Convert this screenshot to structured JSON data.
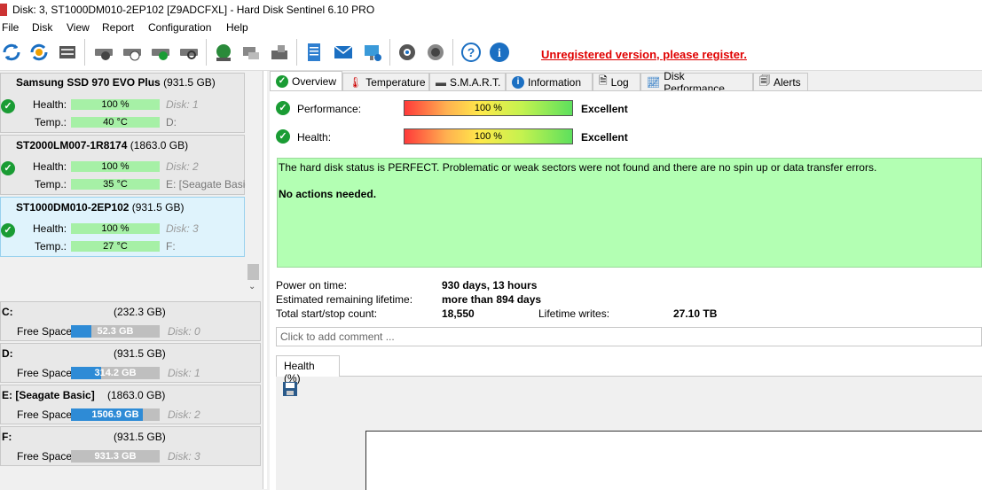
{
  "window": {
    "title": "Disk: 3, ST1000DM010-2EP102 [Z9ADCFXL]  -  Hard Disk Sentinel 6.10 PRO"
  },
  "menu": [
    "File",
    "Disk",
    "View",
    "Report",
    "Configuration",
    "Help"
  ],
  "toolbar": {
    "icons": [
      "refresh-icon",
      "refresh-all-icon",
      "disk-list-icon",
      "disk-test-icon",
      "disk-schedule-icon",
      "disk-ok-icon",
      "disk-search-icon",
      "web-update-icon",
      "network-icon",
      "drive-tools-icon",
      "report-icon",
      "email-icon",
      "alert-icon",
      "settings-icon",
      "sound-icon",
      "help-icon",
      "info-icon"
    ],
    "register_message": "Unregistered version, please register."
  },
  "disks": [
    {
      "name": "Samsung SSD 970 EVO Plus",
      "size": "(931.5 GB)",
      "health_label": "Health:",
      "health": "100 %",
      "health_pct": 100,
      "temp_label": "Temp.:",
      "temp": "40 °C",
      "temp_pct": 40,
      "disk_num": "Disk: 1",
      "drive": "D:"
    },
    {
      "name": "ST2000LM007-1R8174",
      "size": "(1863.0 GB)",
      "health_label": "Health:",
      "health": "100 %",
      "health_pct": 100,
      "temp_label": "Temp.:",
      "temp": "35 °C",
      "temp_pct": 35,
      "disk_num": "Disk: 2",
      "drive": "E: [Seagate Basic"
    },
    {
      "name": "ST1000DM010-2EP102",
      "size": "(931.5 GB)",
      "health_label": "Health:",
      "health": "100 %",
      "health_pct": 100,
      "temp_label": "Temp.:",
      "temp": "27 °C",
      "temp_pct": 27,
      "disk_num": "Disk: 3",
      "drive": "F:"
    }
  ],
  "volumes": [
    {
      "letter": "C:",
      "size": "(232.3 GB)",
      "free_label": "Free Space",
      "free": "52.3 GB",
      "free_frac": 0.225,
      "disk": "Disk: 0",
      "color": "#2e8bd6"
    },
    {
      "letter": "D:",
      "size": "(931.5 GB)",
      "free_label": "Free Space",
      "free": "314.2 GB",
      "free_frac": 0.337,
      "disk": "Disk: 1",
      "color": "#2e8bd6"
    },
    {
      "letter": "E: [Seagate Basic]",
      "size": "(1863.0 GB)",
      "free_label": "Free Space",
      "free": "1506.9 GB",
      "free_frac": 0.809,
      "disk": "Disk: 2",
      "color": "#2e8bd6"
    },
    {
      "letter": "F:",
      "size": "(931.5 GB)",
      "free_label": "Free Space",
      "free": "931.3 GB",
      "free_frac": 0.0,
      "disk": "Disk: 3",
      "color": "#2e8bd6"
    }
  ],
  "tabs": [
    "Overview",
    "Temperature",
    "S.M.A.R.T.",
    "Information",
    "Log",
    "Disk Performance",
    "Alerts"
  ],
  "overview": {
    "performance_label": "Performance:",
    "performance": "100 %",
    "performance_status": "Excellent",
    "health_label": "Health:",
    "health": "100 %",
    "health_status": "Excellent",
    "status_text": "The hard disk status is PERFECT. Problematic or weak sectors were not found and there are no spin up or data transfer errors.",
    "status_action": "No actions needed.",
    "power_on_label": "Power on time:",
    "power_on": "930 days, 13 hours",
    "lifetime_label": "Estimated remaining lifetime:",
    "lifetime": "more than 894 days",
    "startstop_label": "Total start/stop count:",
    "startstop": "18,550",
    "writes_label": "Lifetime writes:",
    "writes": "27.10 TB",
    "comment_placeholder": "Click to add comment ...",
    "chart_tab": "Health (%)"
  }
}
